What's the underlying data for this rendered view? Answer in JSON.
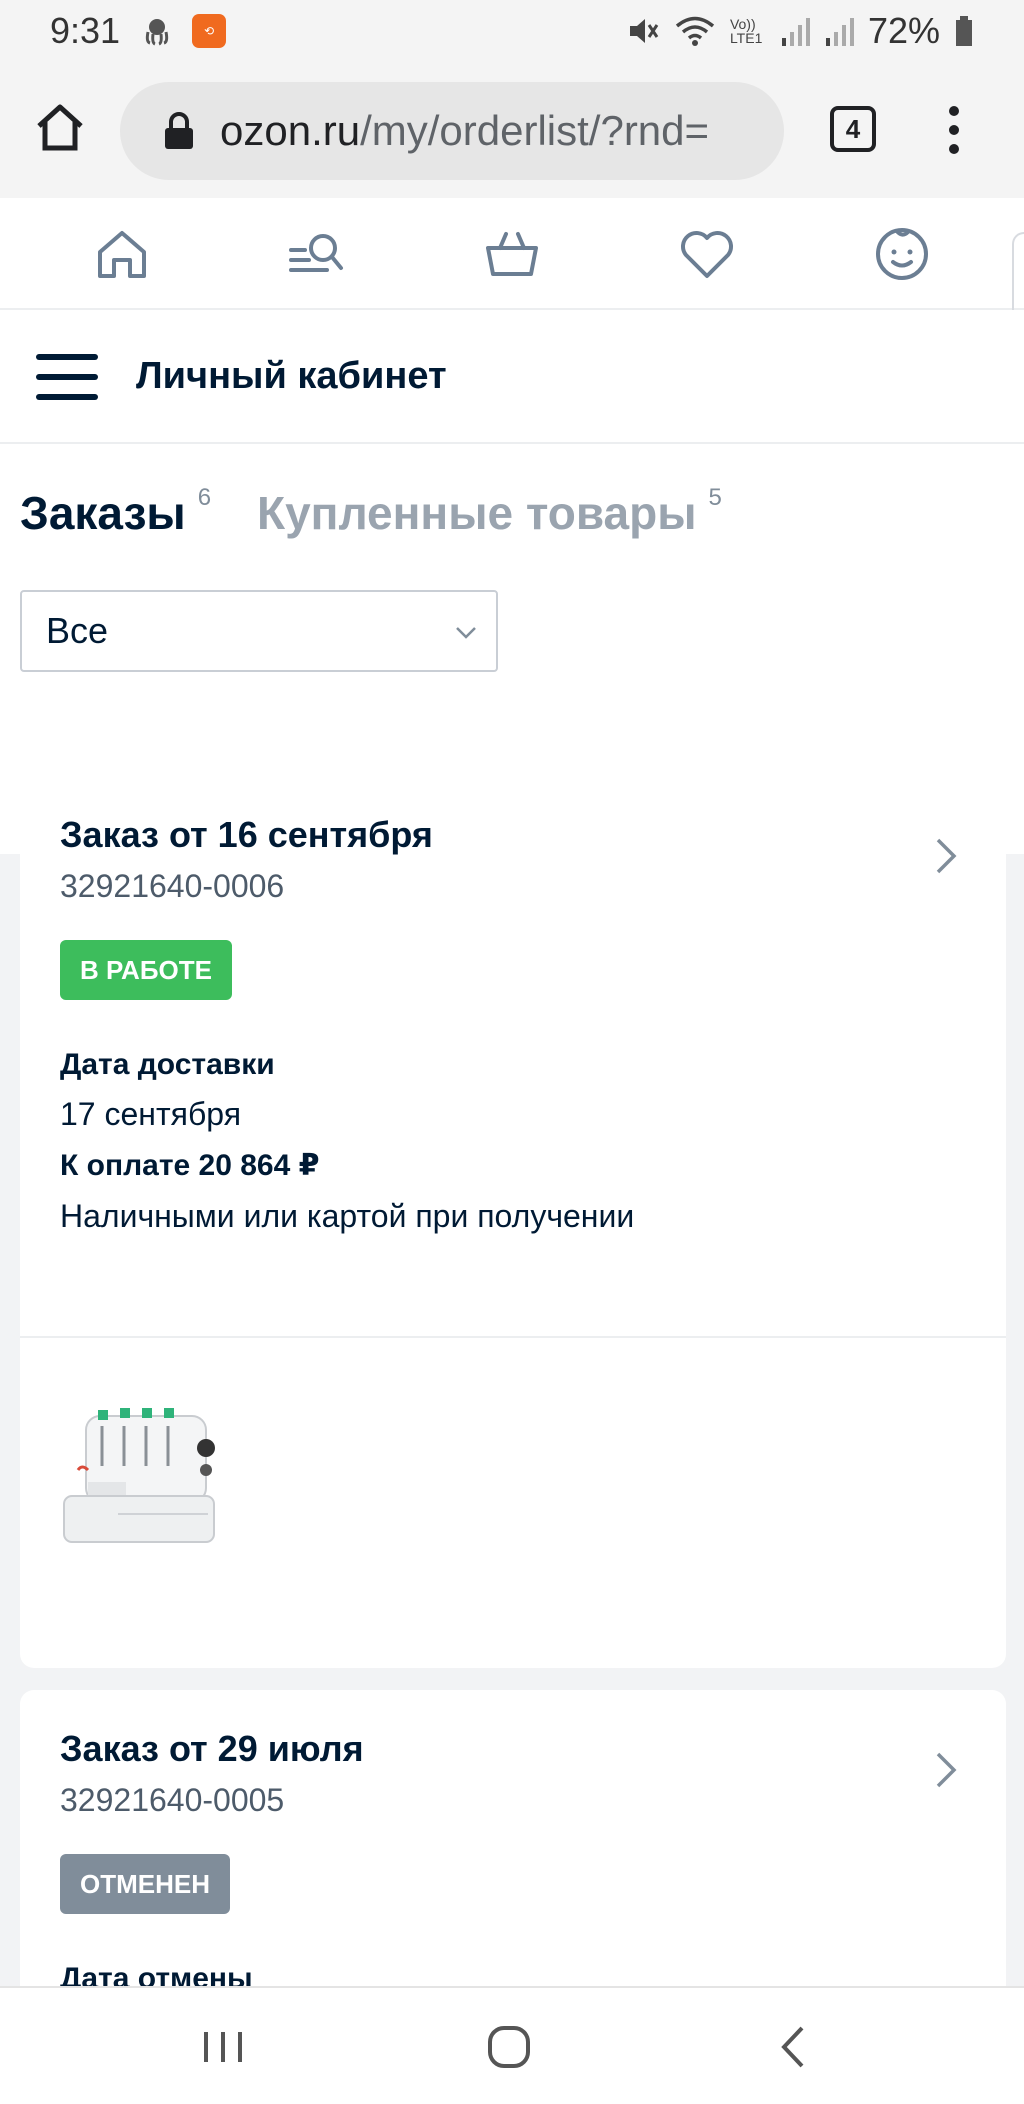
{
  "status_bar": {
    "time": "9:31",
    "battery": "72%",
    "network": "Vo)) LTE1"
  },
  "browser": {
    "url_host": "ozon.ru",
    "url_path": "/my/orderlist/?rnd=",
    "tabs_count": "4"
  },
  "site_nav": {
    "icons": [
      "home-icon",
      "catalog-search-icon",
      "cart-icon",
      "favorites-icon",
      "profile-icon"
    ]
  },
  "header": {
    "title": "Личный кабинет"
  },
  "tabs": {
    "orders_label": "Заказы",
    "orders_count": "6",
    "bought_label": "Купленные товары",
    "bought_count": "5"
  },
  "filter": {
    "selected": "Все"
  },
  "orders": [
    {
      "title": "Заказ от 16 сентября",
      "number": "32921640-0006",
      "status": "В РАБОТЕ",
      "status_color": "#3dbd5c",
      "delivery_label": "Дата доставки",
      "delivery_date": "17 сентября",
      "payment_label": "К оплате 20 864 ₽",
      "payment_method": "Наличными или картой при получении"
    },
    {
      "title": "Заказ от 29 июля",
      "number": "32921640-0005",
      "status": "ОТМЕНЕН",
      "status_color": "#808d9a",
      "cancel_label": "Дата отмены"
    }
  ]
}
